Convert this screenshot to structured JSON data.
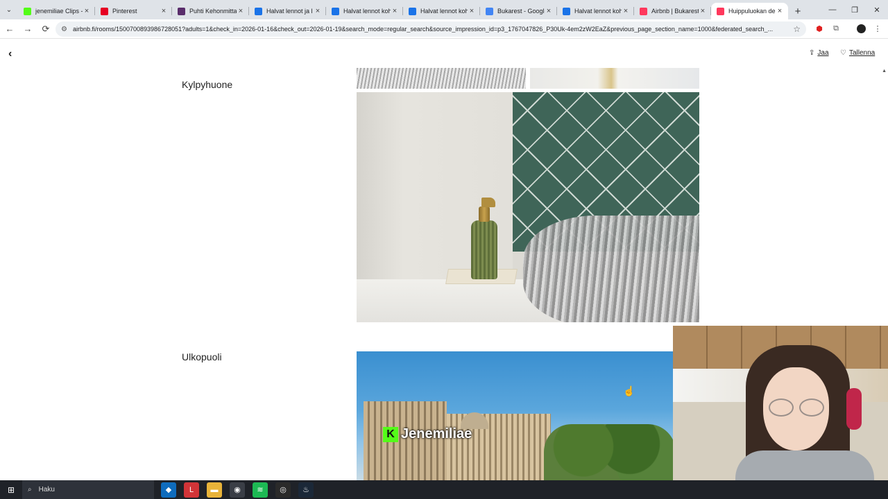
{
  "browser": {
    "tabs": [
      {
        "title": "jenemiliae Clips -",
        "favicon_color": "#53fc18",
        "active": false
      },
      {
        "title": "Pinterest",
        "favicon_color": "#e60023",
        "active": false
      },
      {
        "title": "Puhti Kehonmitta",
        "favicon_color": "#5a2d6b",
        "active": false
      },
      {
        "title": "Halvat lennot ja l",
        "favicon_color": "#1a73e8",
        "active": false
      },
      {
        "title": "Halvat lennot koh",
        "favicon_color": "#1a73e8",
        "active": false
      },
      {
        "title": "Halvat lennot koh",
        "favicon_color": "#1a73e8",
        "active": false
      },
      {
        "title": "Bukarest - Google",
        "favicon_color": "#4285f4",
        "active": false
      },
      {
        "title": "Halvat lennot koh",
        "favicon_color": "#1a73e8",
        "active": false
      },
      {
        "title": "Airbnb | Bukarest",
        "favicon_color": "#ff385c",
        "active": false
      },
      {
        "title": "Huippuluokan de",
        "favicon_color": "#ff385c",
        "active": true
      }
    ],
    "tab_close": "×",
    "new_tab": "+",
    "menu_icon": "⌄",
    "window": {
      "minimize": "—",
      "maximize": "❐",
      "close": "✕"
    },
    "nav": {
      "back": "←",
      "forward": "→",
      "reload": "⟳"
    },
    "url": "airbnb.fi/rooms/1500700893986728051?adults=1&check_in=2026-01-16&check_out=2026-01-19&search_mode=regular_search&source_impression_id=p3_1767047826_P30Uk-4em2zW2EaZ&previous_page_section_name=1000&federated_search_...",
    "star": "☆"
  },
  "page": {
    "back": "‹",
    "share_icon": "⇪",
    "share_label": "Jaa",
    "save_icon": "♡",
    "save_label": "Tallenna",
    "sections": [
      {
        "title": "Kylpyhuone"
      },
      {
        "title": "Ulkopuoli"
      }
    ],
    "scroll_up": "▲"
  },
  "overlay": {
    "watermark_logo": "K",
    "watermark_text": "Jenemiliae"
  },
  "cursor": "☝",
  "taskbar": {
    "start_icon": "⊞",
    "search_icon": "⌕",
    "search_placeholder": "Haku",
    "apps": [
      {
        "name": "outlook-icon",
        "glyph": "◆",
        "color": "#0f6cbd"
      },
      {
        "name": "lapp-icon",
        "glyph": "L",
        "color": "#d13438"
      },
      {
        "name": "file-explorer-icon",
        "glyph": "▬",
        "color": "#e8b339"
      },
      {
        "name": "chrome-icon",
        "glyph": "◉",
        "color": "#3a3e46"
      },
      {
        "name": "spotify-icon",
        "glyph": "≋",
        "color": "#1db954"
      },
      {
        "name": "obs-icon",
        "glyph": "◎",
        "color": "#2a2a2a"
      },
      {
        "name": "steam-icon",
        "glyph": "♨",
        "color": "#1b2838"
      }
    ]
  }
}
